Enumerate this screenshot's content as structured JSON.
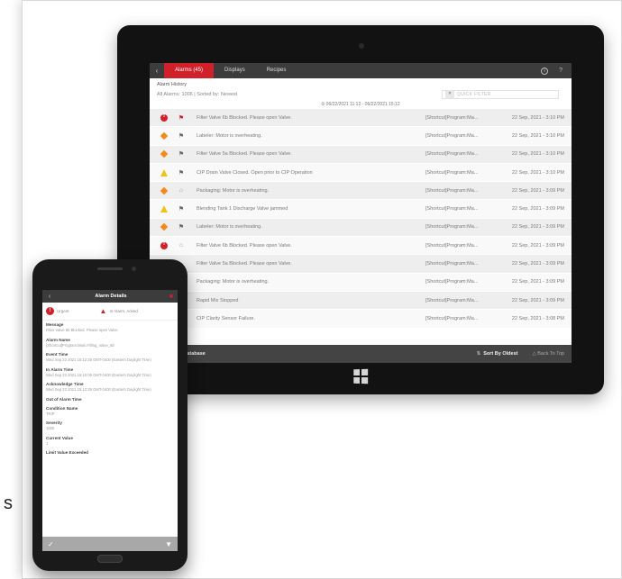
{
  "stray_letter": "s",
  "tablet": {
    "tabs": [
      {
        "label": "Alarms (45)",
        "active": true
      },
      {
        "label": "Displays",
        "active": false
      },
      {
        "label": "Recipes",
        "active": false
      }
    ],
    "info_icon": "info-circle-icon",
    "help_label": "?",
    "history_title": "Alarm History",
    "history_subtitle": "All Alarms: 1006  |  Sorted by: Newest",
    "filter_placeholder": "QUICK FILTER",
    "range_label": "⏲ 06/22/2021 11:12 - 06/22/2021 15:12",
    "alarms": [
      {
        "severity": "urgent",
        "state": "alarm",
        "message": "Filter Valve 6b Blocked. Please open Valve.",
        "source": "[Shortcut]Program:Ma...",
        "time": "22 Sep, 2021 - 3:10 PM"
      },
      {
        "severity": "high",
        "state": "normal",
        "message": "Labeler: Motor is overheating.",
        "source": "[Shortcut]Program:Ma...",
        "time": "22 Sep, 2021 - 3:10 PM"
      },
      {
        "severity": "high",
        "state": "normal",
        "message": "Filter Valve 5a Blocked. Please open Valve.",
        "source": "[Shortcut]Program:Ma...",
        "time": "22 Sep, 2021 - 3:10 PM"
      },
      {
        "severity": "medium",
        "state": "normal",
        "message": "CIP Drain Valve Closed.  Open prior to CIP Operation",
        "source": "[Shortcut]Program:Ma...",
        "time": "22 Sep, 2021 - 3:10 PM"
      },
      {
        "severity": "high",
        "state": "outline",
        "message": "Packaging: Motor is overheating.",
        "source": "[Shortcut]Program:Ma...",
        "time": "22 Sep, 2021 - 3:09 PM"
      },
      {
        "severity": "medium",
        "state": "normal",
        "message": "Blending Tank 1 Discharge Valve jammed",
        "source": "[Shortcut]Program:Ma...",
        "time": "22 Sep, 2021 - 3:09 PM"
      },
      {
        "severity": "high",
        "state": "normal",
        "message": "Labeler: Motor is overheating.",
        "source": "[Shortcut]Program:Ma...",
        "time": "22 Sep, 2021 - 3:09 PM"
      },
      {
        "severity": "urgent",
        "state": "outline",
        "message": "Filter Valve 6b Blocked. Please open Valve.",
        "source": "[Shortcut]Program:Ma...",
        "time": "22 Sep, 2021 - 3:09 PM"
      },
      {
        "severity": "high",
        "state": "outline",
        "message": "Filter Valve 5a Blocked. Please open Valve.",
        "source": "[Shortcut]Program:Ma...",
        "time": "22 Sep, 2021 - 3:09 PM"
      },
      {
        "severity": "high",
        "state": "normal",
        "message": "Packaging: Motor is overheating.",
        "source": "[Shortcut]Program:Ma...",
        "time": "22 Sep, 2021 - 3:09 PM"
      },
      {
        "severity": "high",
        "state": "normal",
        "message": "Rapid Mix Stopped",
        "source": "[Shortcut]Program:Ma...",
        "time": "22 Sep, 2021 - 3:09 PM"
      },
      {
        "severity": "high",
        "state": "normal",
        "message": "CIP Clarity Sensor Failure.",
        "source": "[Shortcut]Program:Ma...",
        "time": "22 Sep, 2021 - 3:08 PM"
      }
    ],
    "footer": {
      "database_label": "t Database",
      "sort_label": "Sort By Oldest",
      "back_to_top_label": "Back To Top"
    }
  },
  "phone": {
    "title": "Alarm Details",
    "status_urgent": "Urgent",
    "status_state": "In Alarm, Acked",
    "fields": [
      {
        "label": "Message",
        "value": "Filter Valve 6b Blocked. Please open Valve."
      },
      {
        "label": "Alarm Name",
        "value": "[Shortcut]Program:Main.Filling_Valve_6b"
      },
      {
        "label": "Event Time",
        "value": "Wed Sep 22 2021 15:12:35 GMT-0400 (Eastern Daylight Time)"
      },
      {
        "label": "In Alarm Time",
        "value": "Wed Sep 22 2021 15:10:05 GMT-0400 (Eastern Daylight Time)"
      },
      {
        "label": "Acknowledge Time",
        "value": "Wed Sep 22 2021 15:12:35 GMT-0400 (Eastern Daylight Time)"
      },
      {
        "label": "Out of Alarm Time",
        "value": ""
      },
      {
        "label": "Condition Name",
        "value": "TRIP"
      },
      {
        "label": "Severity",
        "value": "1000"
      },
      {
        "label": "Current Value",
        "value": "1"
      },
      {
        "label": "Limit Value Exceeded",
        "value": ""
      }
    ]
  }
}
